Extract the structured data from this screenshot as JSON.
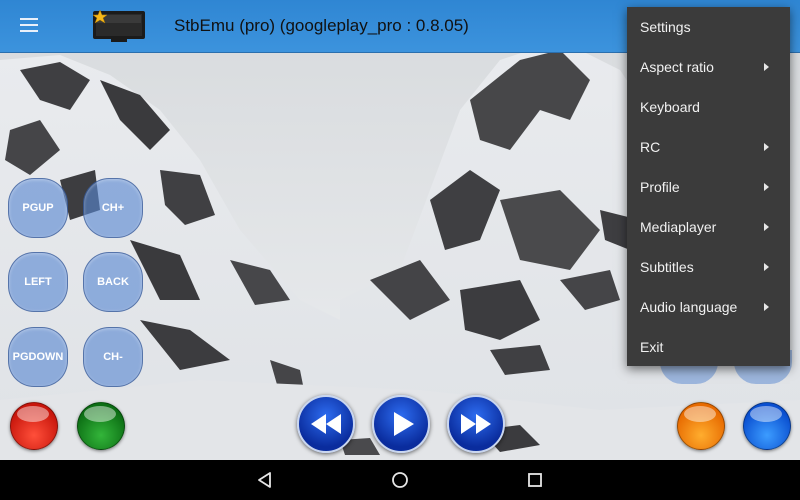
{
  "app": {
    "title": "StbEmu (pro) (googleplay_pro : 0.8.05)"
  },
  "icons": {
    "menu": "hamburger-menu-icon",
    "logo": "tv-logo-icon",
    "back": "nav-back-icon",
    "home": "nav-home-icon",
    "recents": "nav-recents-icon"
  },
  "menu": {
    "items": [
      {
        "label": "Settings",
        "submenu": false
      },
      {
        "label": "Aspect ratio",
        "submenu": true
      },
      {
        "label": "Keyboard",
        "submenu": false
      },
      {
        "label": "RC",
        "submenu": true
      },
      {
        "label": "Profile",
        "submenu": true
      },
      {
        "label": "Mediaplayer",
        "submenu": true
      },
      {
        "label": "Subtitles",
        "submenu": true
      },
      {
        "label": "Audio language",
        "submenu": true
      },
      {
        "label": "Exit",
        "submenu": false
      }
    ]
  },
  "keypad": {
    "pgup": "PGUP",
    "ch_plus": "CH+",
    "left": "LEFT",
    "back": "BACK",
    "pgdown": "PGDOWN",
    "ch_minus": "CH-"
  },
  "colors": {
    "appbar": "#3c93dd",
    "menu_bg": "#3b3b3b",
    "keypad": "#5888d2",
    "red": "#e0241a",
    "green": "#128a1e",
    "orange": "#ff8a10",
    "blue": "#1a6cf0"
  }
}
